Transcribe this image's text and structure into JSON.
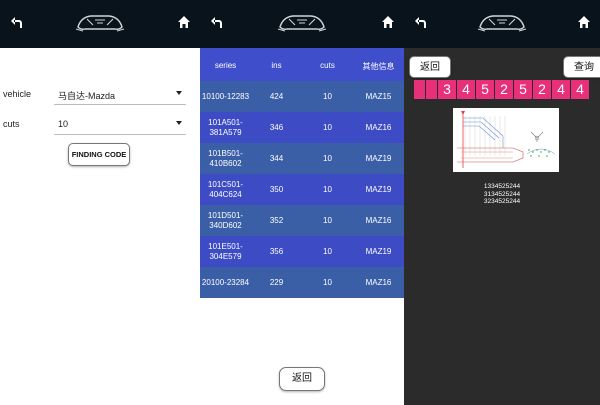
{
  "panel1": {
    "vehicle_label": "vehicle",
    "vehicle_value": "马自达-Mazda",
    "cuts_label": "cuts",
    "cuts_value": "10",
    "finding_button": "FINDING CODE"
  },
  "panel2": {
    "headers": [
      "series",
      "ins",
      "cuts",
      "其他信息"
    ],
    "rows": [
      [
        "10100-12283",
        "424",
        "10",
        "MAZ15"
      ],
      [
        "101A501-\n381A579",
        "346",
        "10",
        "MAZ16"
      ],
      [
        "101B501-\n410B602",
        "344",
        "10",
        "MAZ19"
      ],
      [
        "101C501-\n404C624",
        "350",
        "10",
        "MAZ19"
      ],
      [
        "101D501-\n340D602",
        "352",
        "10",
        "MAZ16"
      ],
      [
        "101E501-\n304E579",
        "356",
        "10",
        "MAZ19"
      ],
      [
        "20100-23284",
        "229",
        "10",
        "MAZ16"
      ]
    ],
    "back_button": "返回"
  },
  "panel3": {
    "back_button": "返回",
    "query_button": "查询",
    "cuts": [
      "",
      "",
      "3",
      "4",
      "5",
      "2",
      "5",
      "2",
      "4",
      "4"
    ],
    "codes": [
      "1334525244",
      "3134525244",
      "3234525244"
    ]
  },
  "colors": {
    "topbar": "#08131b",
    "table_header": "#3f4fcb",
    "row_blue": "#3d4cc4",
    "row_slate": "#3b5fa6",
    "cut_pink": "#e8307a"
  },
  "icons": [
    "back-arrow-icon",
    "car-logo-icon",
    "home-icon"
  ]
}
